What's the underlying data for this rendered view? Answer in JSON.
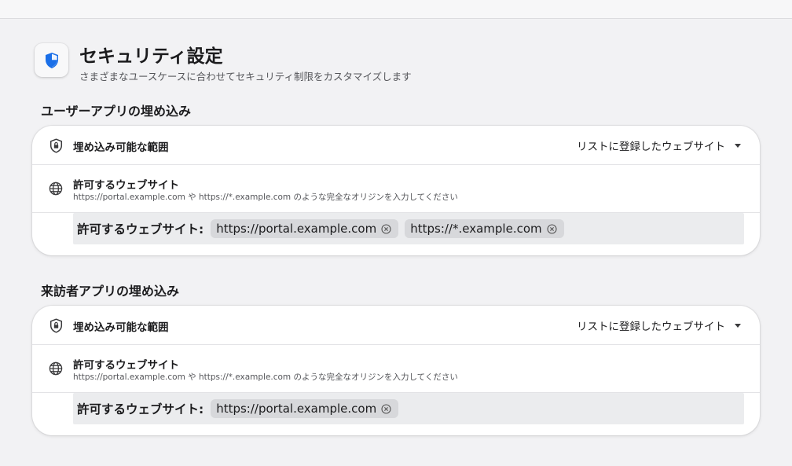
{
  "header": {
    "title": "セキュリティ設定",
    "subtitle": "さまざまなユースケースに合わせてセキュリティ制限をカスタマイズします",
    "icon": "shield-check-icon",
    "accent_color": "#1a6fe8"
  },
  "sections": [
    {
      "title": "ユーザーアプリの埋め込み",
      "scope_label": "埋め込み可能な範囲",
      "scope_value": "リストに登録したウェブサイト",
      "allowed_title": "許可するウェブサイト",
      "allowed_description": "https://portal.example.com や https://*.example.com のような完全なオリジンを入力してください",
      "field_label": "許可するウェブサイト:",
      "chips": [
        "https://portal.example.com",
        "https://*.example.com"
      ]
    },
    {
      "title": "来訪者アプリの埋め込み",
      "scope_label": "埋め込み可能な範囲",
      "scope_value": "リストに登録したウェブサイト",
      "allowed_title": "許可するウェブサイト",
      "allowed_description": "https://portal.example.com や https://*.example.com のような完全なオリジンを入力してください",
      "field_label": "許可するウェブサイト:",
      "chips": [
        "https://portal.example.com"
      ]
    }
  ]
}
